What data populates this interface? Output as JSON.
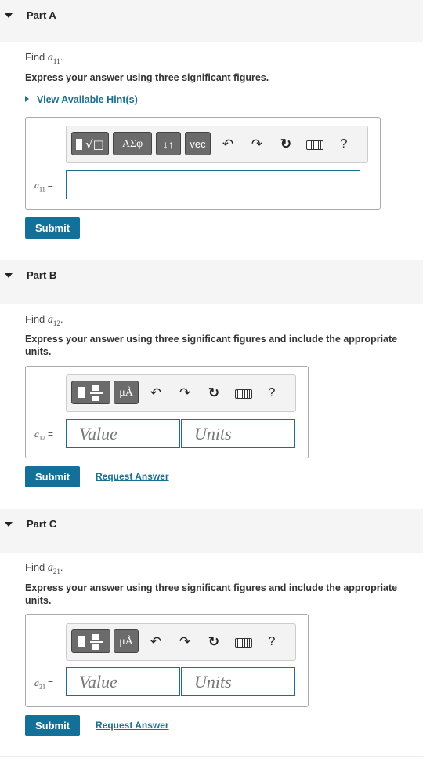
{
  "parts": [
    {
      "title": "Part A",
      "find_prefix": "Find ",
      "var": "a",
      "sub": "11",
      "instruction": "Express your answer using three significant figures.",
      "hint": "View Available Hint(s)",
      "submit": "Submit"
    },
    {
      "title": "Part B",
      "find_prefix": "Find ",
      "var": "a",
      "sub": "12",
      "instruction": "Express your answer using three significant figures and include the appropriate units.",
      "value_placeholder": "Value",
      "units_placeholder": "Units",
      "submit": "Submit",
      "request": "Request Answer"
    },
    {
      "title": "Part C",
      "find_prefix": "Find ",
      "var": "a",
      "sub": "21",
      "instruction": "Express your answer using three significant figures and include the appropriate units.",
      "value_placeholder": "Value",
      "units_placeholder": "Units",
      "submit": "Submit",
      "request": "Request Answer"
    }
  ],
  "toolbar": {
    "greek": "ΑΣφ",
    "arrows": "↓↑",
    "vec": "vec",
    "help": "?",
    "mu": "μÅ",
    "undo": "↶",
    "redo": "↷",
    "reset": "↻"
  },
  "eq_sign": "=",
  "period": "."
}
